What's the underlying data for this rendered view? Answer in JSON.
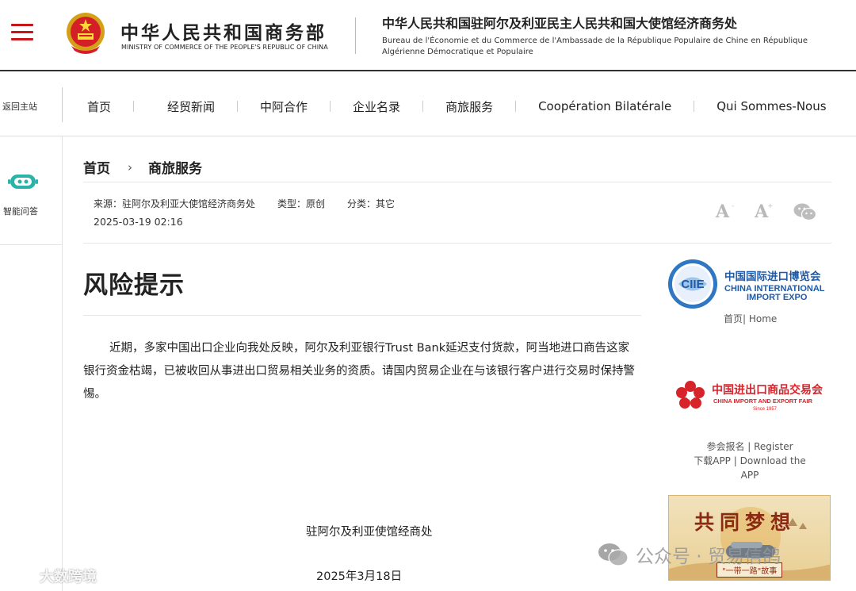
{
  "header": {
    "ministry_cn": "中华人民共和国商务部",
    "ministry_en": "MINISTRY OF COMMERCE OF THE PEOPLE'S REPUBLIC OF CHINA",
    "bureau_cn": "中华人民共和国驻阿尔及利亚民主人民共和国大使馆经济商务处",
    "bureau_fr": "Bureau de l'Économie et du Commerce de l'Ambassade de la République Populaire de Chine en République Algérienne Démocratique et Populaire"
  },
  "nav": {
    "back_home": "返回主站",
    "items": [
      "首页",
      "经贸新闻",
      "中阿合作",
      "企业名录",
      "商旅服务",
      "Coopération Bilatérale",
      "Qui Sommes-Nous"
    ]
  },
  "sidebar": {
    "assistant_label": "智能问答"
  },
  "breadcrumb": {
    "home": "首页",
    "arrow": "›",
    "current": "商旅服务"
  },
  "meta": {
    "source": "来源：驻阿尔及利亚大使馆经济商务处",
    "type": "类型：原创",
    "category": "分类：其它",
    "date": "2025-03-19 02:16"
  },
  "tools": {
    "font_small": "A",
    "font_small_sign": "-",
    "font_large": "A",
    "font_large_sign": "+"
  },
  "article": {
    "title": "风险提示",
    "body": "近期，多家中国出口企业向我处反映，阿尔及利亚银行Trust Bank延迟支付货款，阿当地进口商告这家银行资金枯竭，已被收回从事进出口贸易相关业务的资质。请国内贸易企业在与该银行客户进行交易时保持警惕。",
    "sign_org": "驻阿尔及利亚使馆经商处",
    "sign_date": "2025年3月18日"
  },
  "right": {
    "ciie_cn": "中国国际进口博览会",
    "ciie_en1": "CHINA INTERNATIONAL",
    "ciie_en2": "IMPORT EXPO",
    "ciie_mark": "CIIE",
    "ciie_links": "首页| Home",
    "canton_cn": "中国进出口商品交易会",
    "canton_en": "CHINA IMPORT AND EXPORT FAIR",
    "canton_since": "Since 1957",
    "canton_register": "参会报名 | Register",
    "canton_app": "下载APP | Download the APP",
    "dream_title": "共同梦想",
    "dream_sub": "\"一带一路\"故事"
  },
  "watermarks": {
    "left": "大数跨境",
    "right": "公众号 · 贸易信鸽"
  },
  "colors": {
    "accent_red": "#c8161d",
    "teal": "#2bb3a8",
    "ciie_blue": "#1f5aa6"
  }
}
